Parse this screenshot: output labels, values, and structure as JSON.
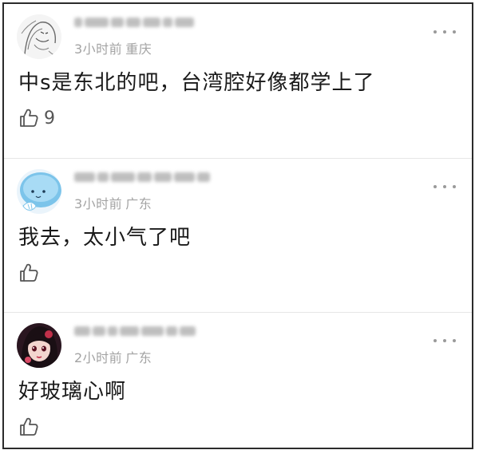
{
  "comments": [
    {
      "time": "3小时前",
      "location": "重庆",
      "text": "中s是东北的吧，台湾腔好像都学上了",
      "likes": "9",
      "avatar_icon": "sketch-portrait-avatar"
    },
    {
      "time": "3小时前",
      "location": "广东",
      "text": "我去，太小气了吧",
      "likes": "",
      "avatar_icon": "blue-cartoon-avatar"
    },
    {
      "time": "2小时前",
      "location": "广东",
      "text": "好玻璃心啊",
      "likes": "",
      "avatar_icon": "anime-girl-avatar"
    }
  ],
  "icons": {
    "like": "thumbs-up-icon",
    "more": "more-dots-icon"
  },
  "colors": {
    "border": "#2b2b2b",
    "meta_text": "#a3a3a3",
    "body_text": "#1a1a1a",
    "divider": "#e6e6e6"
  }
}
